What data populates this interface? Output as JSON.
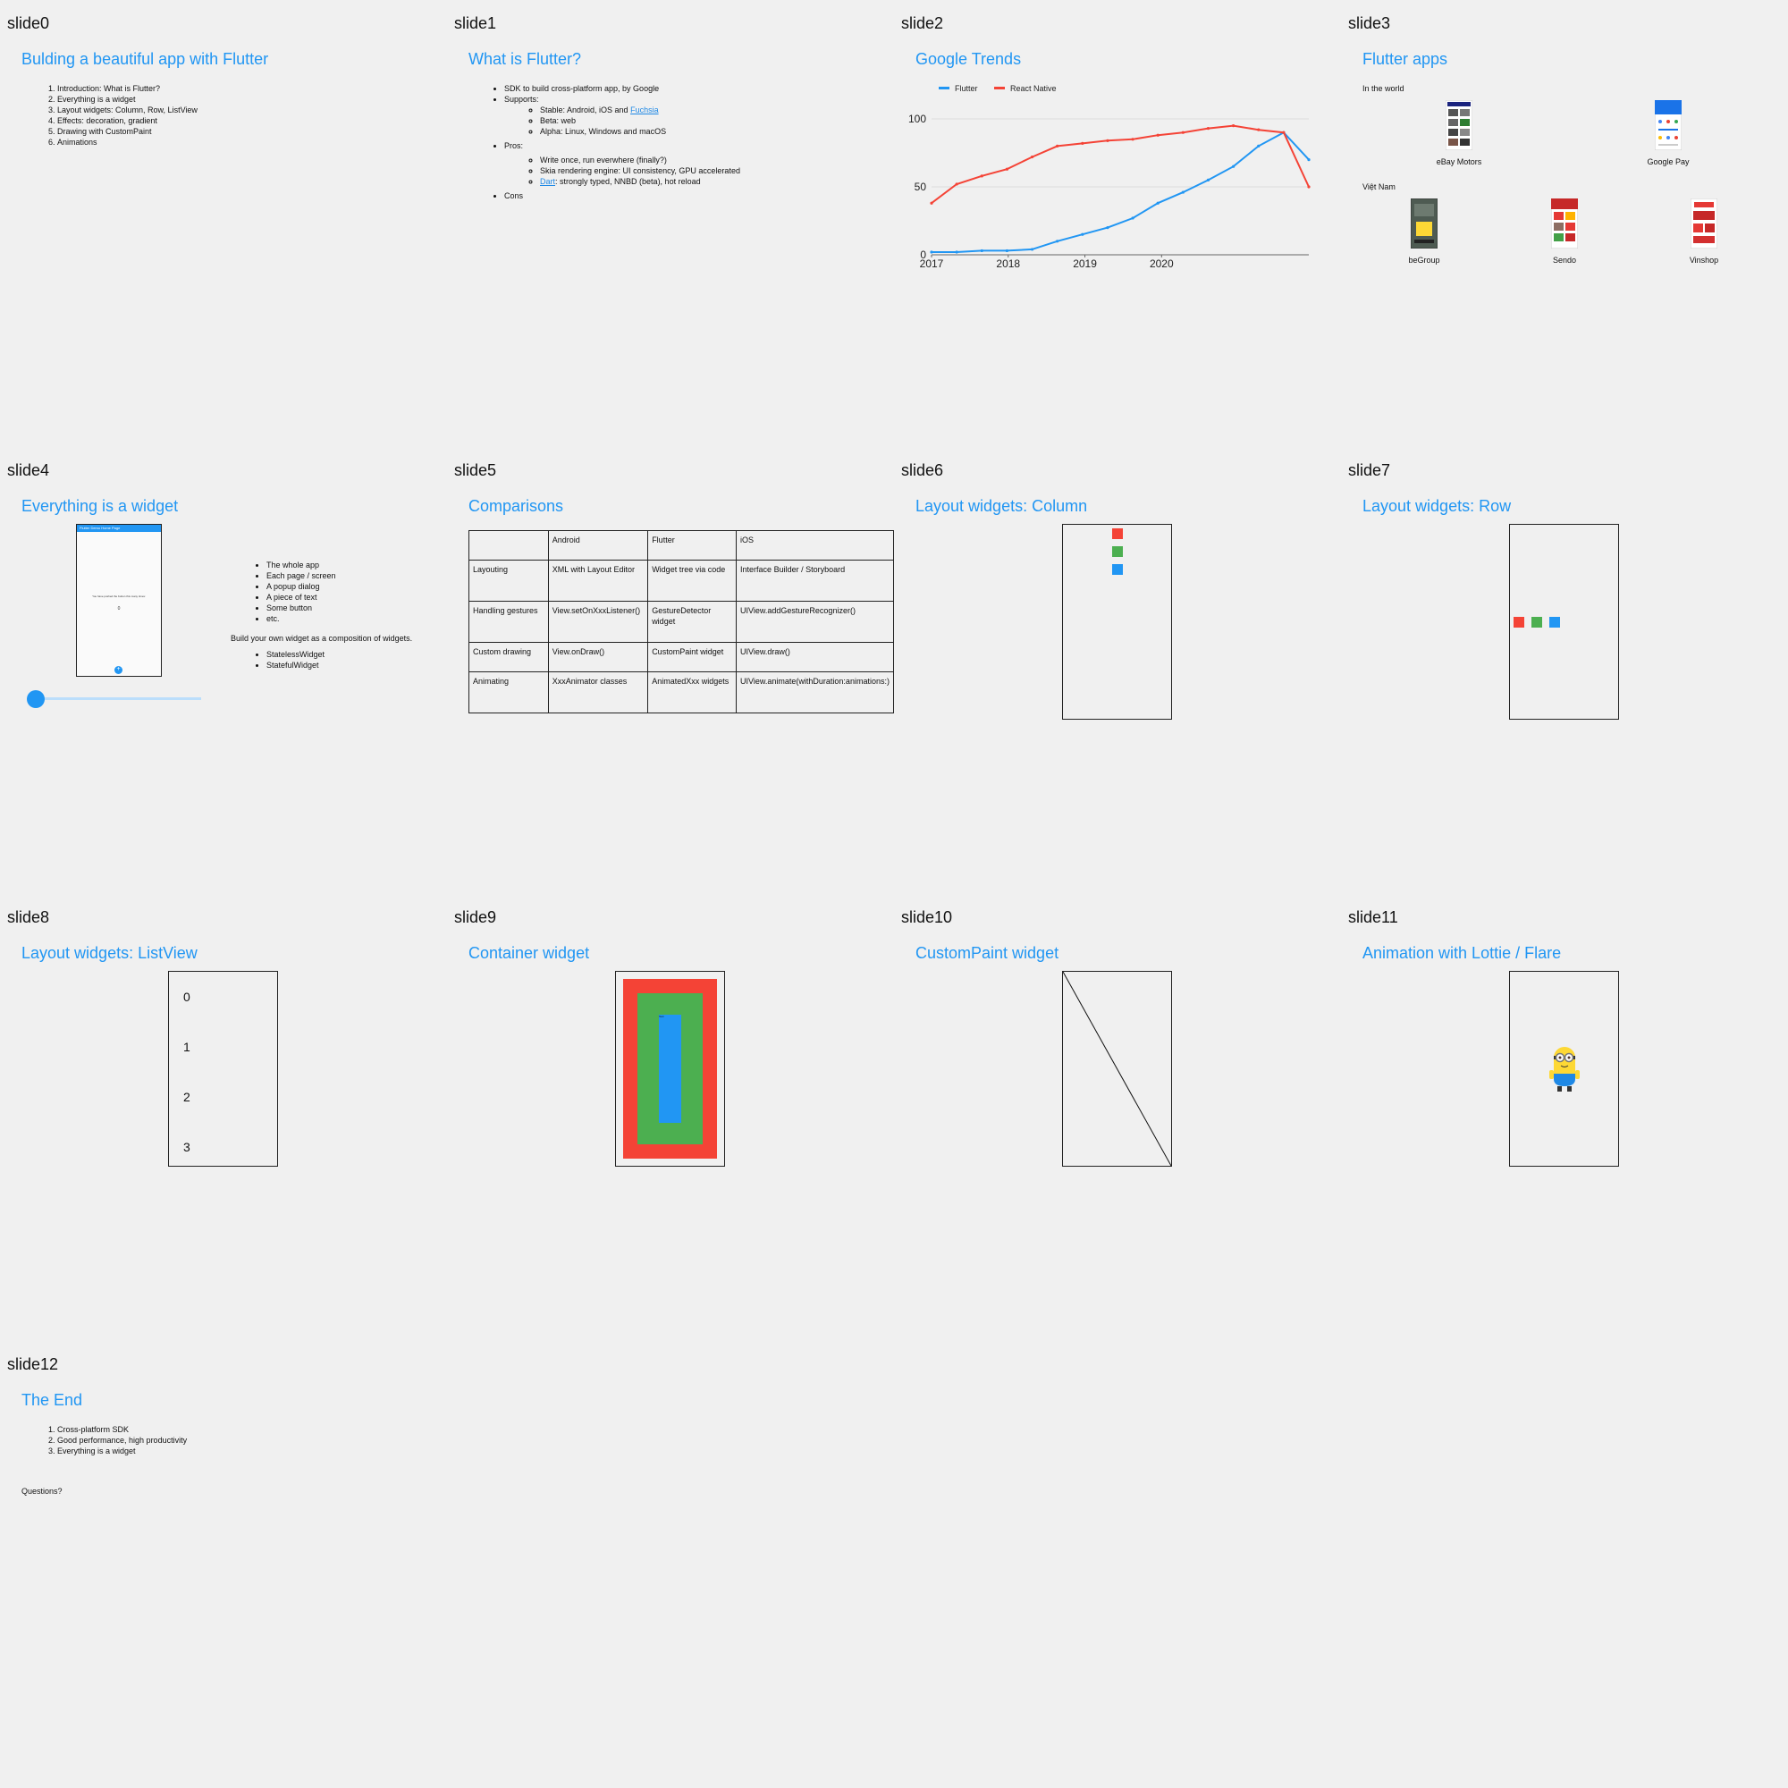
{
  "slides": {
    "s0": {
      "label": "slide0",
      "title": "Bulding a beautiful app with Flutter",
      "items": [
        "Introduction: What is Flutter?",
        "Everything is a widget",
        "Layout widgets: Column, Row, ListView",
        "Effects: decoration, gradient",
        "Drawing with CustomPaint",
        "Animations"
      ]
    },
    "s1": {
      "label": "slide1",
      "title": "What is Flutter?",
      "b1": "SDK to build cross-platform app, by Google",
      "b2": "Supports:",
      "stable_prefix": "Stable: Android, iOS and ",
      "stable_link": "Fuchsia",
      "beta": "Beta: web",
      "alpha": "Alpha: Linux, Windows and macOS",
      "b3": "Pros:",
      "pro1": "Write once, run everwhere (finally?)",
      "pro2": "Skia rendering engine: UI consistency, GPU accelerated",
      "pro3_link": "Dart",
      "pro3_rest": ": strongly typed, NNBD (beta), hot reload",
      "b4": "Cons"
    },
    "s2": {
      "label": "slide2",
      "title": "Google Trends"
    },
    "s3": {
      "label": "slide3",
      "title": "Flutter apps",
      "world_label": "In the world",
      "vn_label": "Việt Nam",
      "apps_world": [
        "eBay Motors",
        "Google Pay"
      ],
      "apps_vn": [
        "beGroup",
        "Sendo",
        "Vinshop"
      ]
    },
    "s4": {
      "label": "slide4",
      "title": "Everything is a widget",
      "phone_title": "Flutter Demo Home Page",
      "phone_text": "You have pushed the button this many times:",
      "phone_count": "0",
      "bullets": [
        "The whole app",
        "Each page / screen",
        "A popup dialog",
        "A piece of text",
        "Some button",
        "etc."
      ],
      "build_text": "Build your own widget as a composition of widgets.",
      "kinds": [
        "StatelessWidget",
        "StatefulWidget"
      ],
      "slider_value": 0
    },
    "s5": {
      "label": "slide5",
      "title": "Comparisons",
      "table": [
        [
          "",
          "Android",
          "Flutter",
          "iOS"
        ],
        [
          "Layouting",
          "XML with Layout Editor",
          "Widget tree via code",
          "Interface Builder / Storyboard"
        ],
        [
          "Handling gestures",
          "View.setOnXxxListener()",
          "GestureDetector widget",
          "UIView.addGestureRecognizer()"
        ],
        [
          "Custom drawing",
          "View.onDraw()",
          "CustomPaint widget",
          "UIView.draw()"
        ],
        [
          "Animating",
          "XxxAnimator classes",
          "AnimatedXxx widgets",
          "UIView.animate(withDuration:animations:)"
        ]
      ]
    },
    "s6": {
      "label": "slide6",
      "title": "Layout widgets: Column"
    },
    "s7": {
      "label": "slide7",
      "title": "Layout widgets: Row"
    },
    "s8": {
      "label": "slide8",
      "title": "Layout widgets: ListView",
      "items": [
        "0",
        "1",
        "2",
        "3"
      ]
    },
    "s9": {
      "label": "slide9",
      "title": "Container widget",
      "inner_text": "Text"
    },
    "s10": {
      "label": "slide10",
      "title": "CustomPaint widget"
    },
    "s11": {
      "label": "slide11",
      "title": "Animation with Lottie / Flare"
    },
    "s12": {
      "label": "slide12",
      "title": "The End",
      "items": [
        "Cross-platform SDK",
        "Good performance, high productivity",
        "Everything is a widget"
      ],
      "questions": "Questions?"
    }
  },
  "colors": {
    "accent": "#2196f3",
    "red": "#f44336",
    "green": "#4caf50",
    "blue": "#2196f3",
    "background": "#f0f0f0"
  },
  "chart_data": {
    "type": "line",
    "title": "",
    "xlabel": "",
    "ylabel": "",
    "x_ticks": [
      "2017",
      "2018",
      "2019",
      "2020"
    ],
    "y_ticks": [
      0,
      50,
      100
    ],
    "ylim": [
      0,
      100
    ],
    "legend_position": "top-left",
    "grid": true,
    "x": [
      "2017-01",
      "2017-04",
      "2017-07",
      "2017-10",
      "2018-01",
      "2018-04",
      "2018-07",
      "2018-10",
      "2019-01",
      "2019-04",
      "2019-07",
      "2019-10",
      "2020-01",
      "2020-04",
      "2020-07",
      "2020-10"
    ],
    "series": [
      {
        "name": "Flutter",
        "color": "#2196f3",
        "values": [
          2,
          2,
          3,
          3,
          4,
          10,
          15,
          20,
          27,
          38,
          46,
          55,
          65,
          80,
          90,
          70
        ]
      },
      {
        "name": "React Native",
        "color": "#f44336",
        "values": [
          38,
          52,
          58,
          63,
          72,
          80,
          82,
          84,
          85,
          88,
          90,
          93,
          95,
          92,
          90,
          50
        ]
      }
    ]
  }
}
